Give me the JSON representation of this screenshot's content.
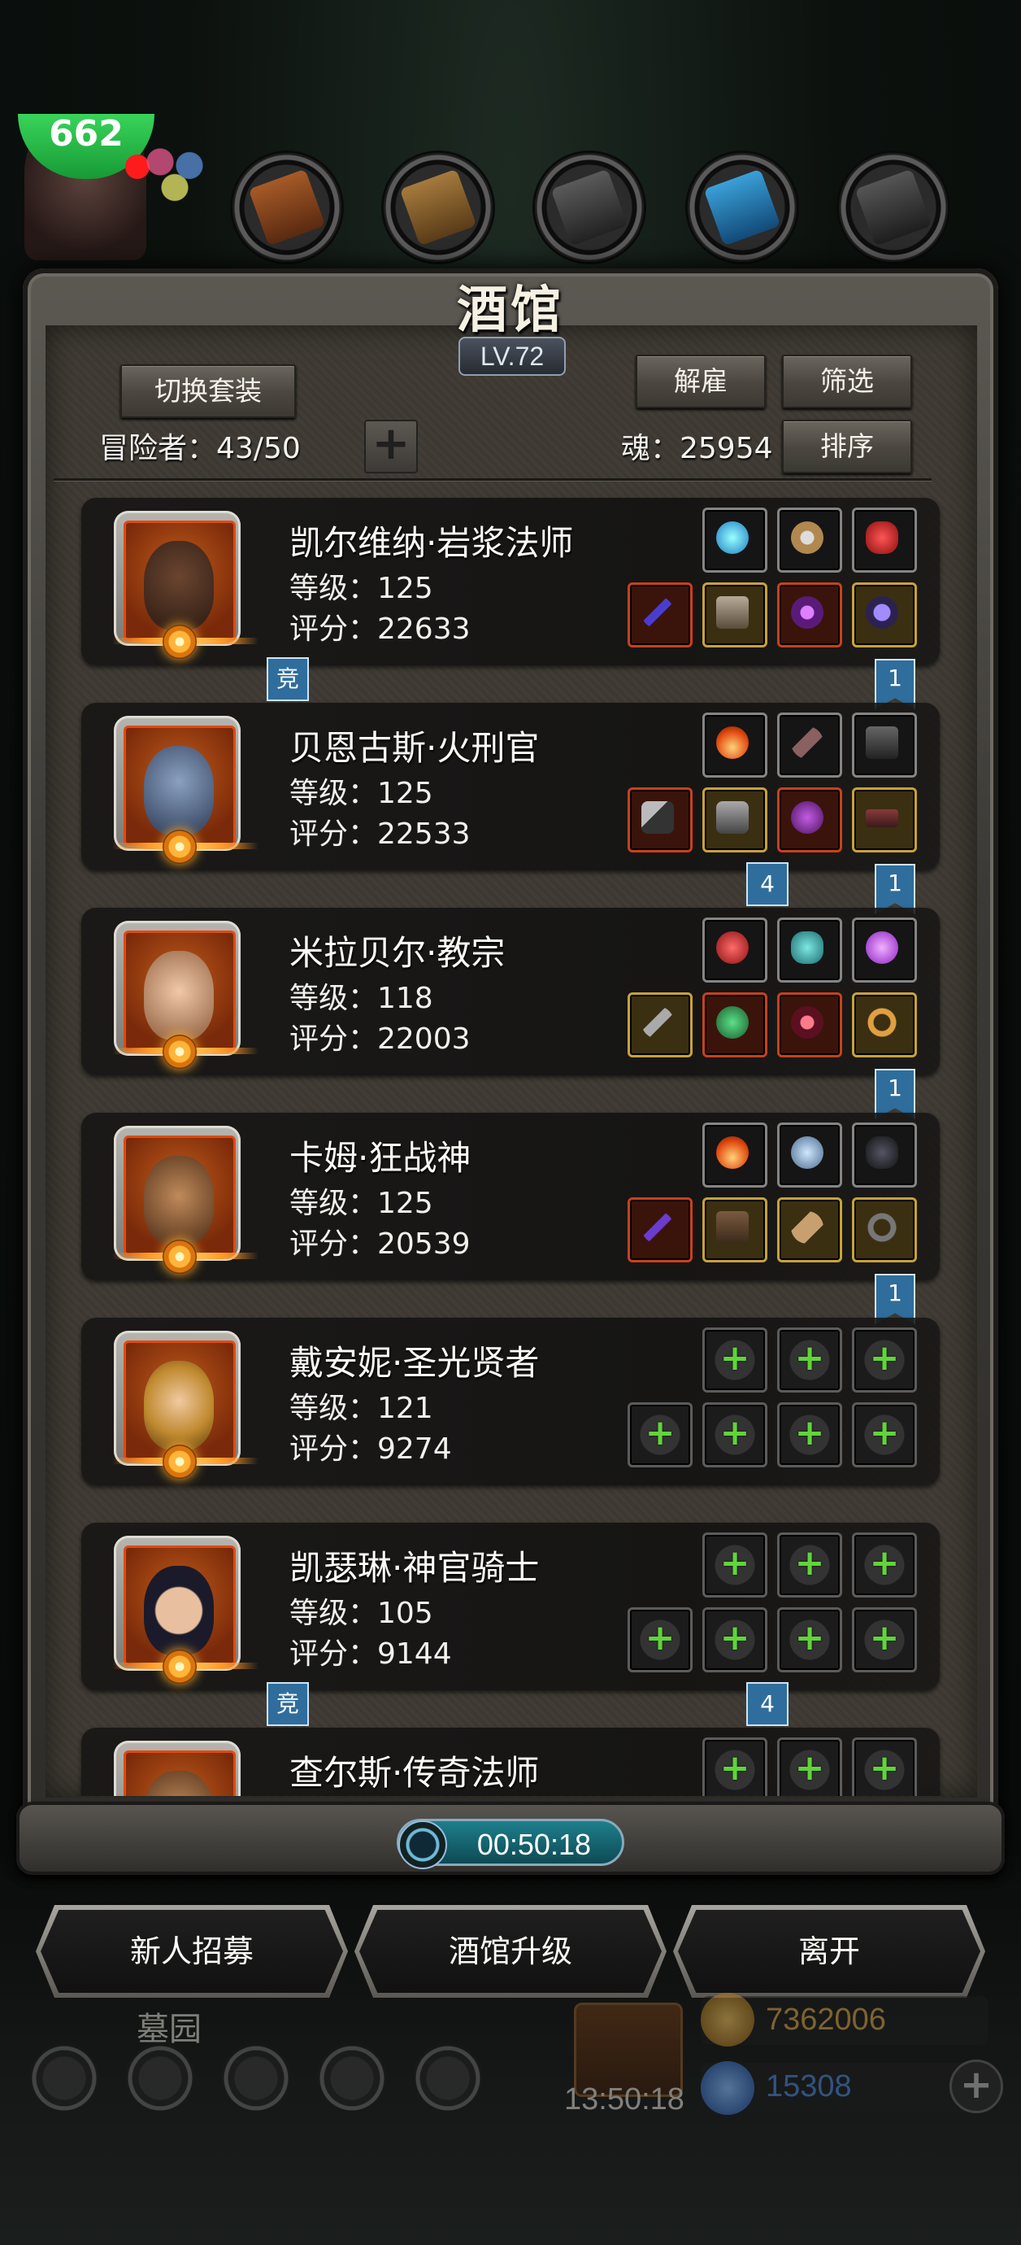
{
  "player": {
    "level_badge": "662"
  },
  "tavern": {
    "title": "酒馆",
    "level": "LV.72",
    "switch_outfit_label": "切换套装",
    "dismiss_label": "解雇",
    "filter_label": "筛选",
    "sort_label": "排序",
    "adventurers_label": "冒险者：43/50",
    "soul_label": "魂：25954",
    "add_label": "+"
  },
  "heroes": [
    {
      "name": "凯尔维纳·岩浆法师",
      "level": "等级：125",
      "score": "评分：22633",
      "tag_left": "竞",
      "tag_right": "1"
    },
    {
      "name": "贝恩古斯·火刑官",
      "level": "等级：125",
      "score": "评分：22533",
      "tag_left": "4",
      "tag_right": "1"
    },
    {
      "name": "米拉贝尔·教宗",
      "level": "等级：118",
      "score": "评分：22003",
      "tag_right": "1"
    },
    {
      "name": "卡姆·狂战神",
      "level": "等级：125",
      "score": "评分：20539",
      "tag_right": "1"
    },
    {
      "name": "戴安妮·圣光贤者",
      "level": "等级：121",
      "score": "评分：9274"
    },
    {
      "name": "凯瑟琳·神官骑士",
      "level": "等级：105",
      "score": "评分：9144",
      "tag_left": "竞",
      "tag_right": "4"
    },
    {
      "name": "查尔斯·传奇法师"
    }
  ],
  "empty_slot_symbol": "+",
  "timer": "00:50:18",
  "actions": {
    "recruit_label": "新人招募",
    "upgrade_label": "酒馆升级",
    "leave_label": "离开"
  },
  "hud": {
    "location": "墓园",
    "gift_timer": "13:50:18",
    "gold": "7362006",
    "gems": "15308",
    "plus": "+"
  },
  "colors": {
    "accent_green": "#61d43a",
    "tag_blue": "#2f6d9c",
    "gold_text": "#d6a54a",
    "gem_text": "#4a86d6"
  }
}
